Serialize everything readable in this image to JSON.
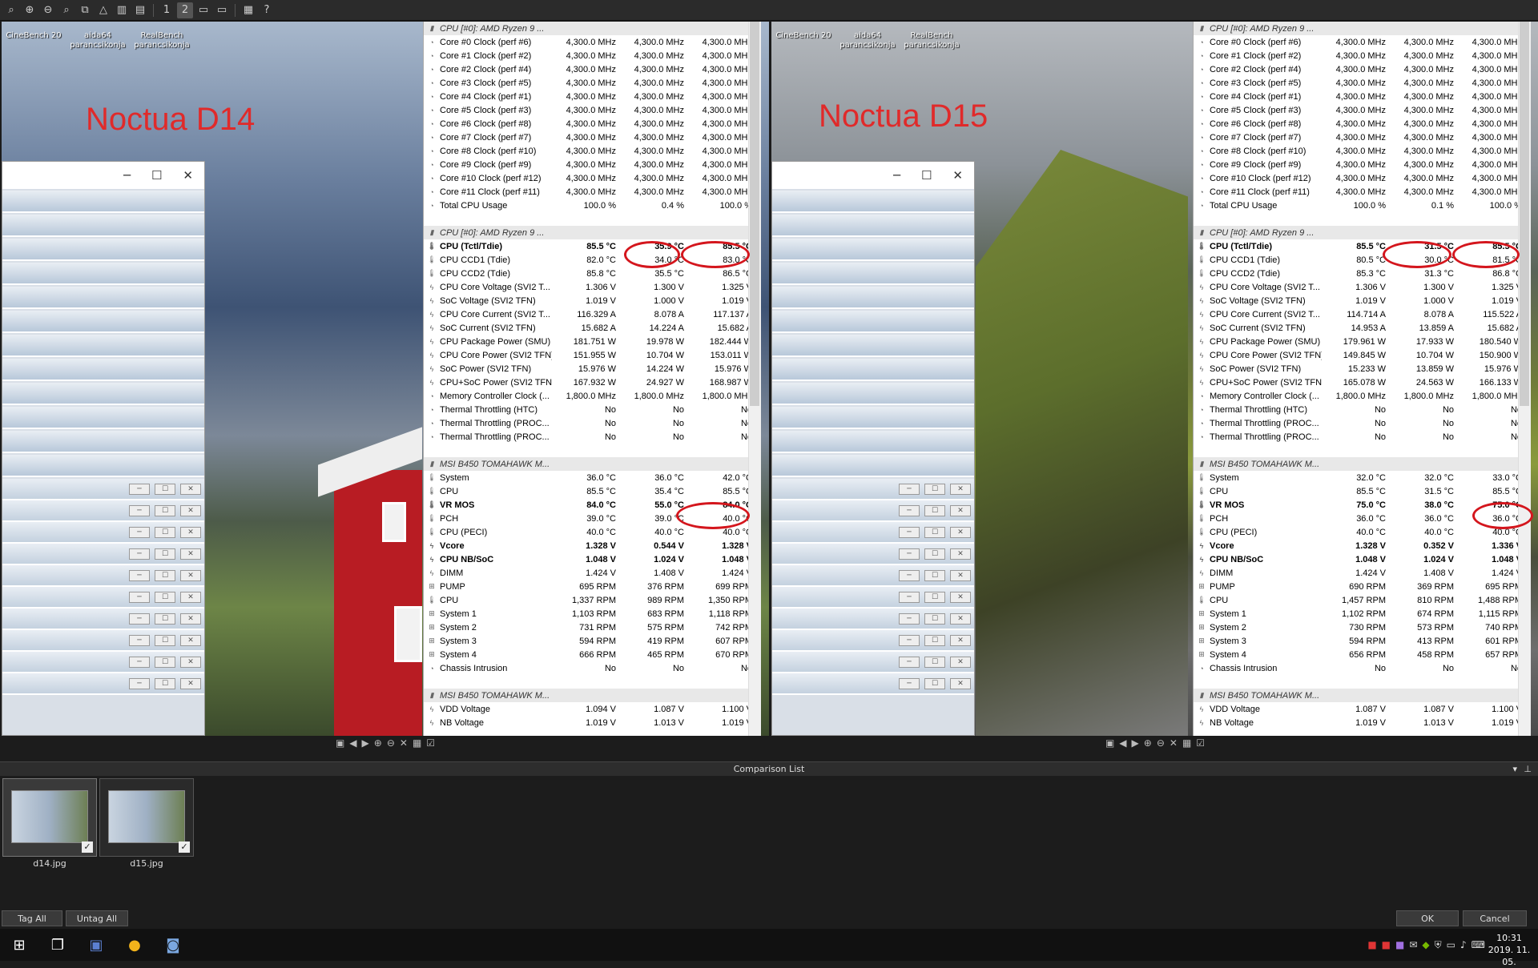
{
  "toolbar": {
    "icons": [
      "search-icon",
      "zoom-in-icon",
      "zoom-out-icon",
      "zoom-icon",
      "copy-icon",
      "sharpen-icon",
      "histogram-icon",
      "adjust-icon",
      "layout-1-icon",
      "layout-2-icon",
      "layout-3-icon",
      "layout-4-icon",
      "grid-icon",
      "help-icon"
    ],
    "layout1": "1",
    "layout2": "2"
  },
  "panels": [
    {
      "title": "Noctua D14",
      "desktop_icons": [
        "CineBench 20",
        "aida64 parancsikonja",
        "RealBench parancsikonja"
      ],
      "hw": [
        {
          "t": "hdr",
          "name": "CPU [#0]: AMD Ryzen 9 ..."
        },
        {
          "name": "Core #0 Clock (perf #6)",
          "a": "4,300.0 MHz",
          "b": "4,300.0 MHz",
          "c": "4,300.0 MHz"
        },
        {
          "name": "Core #1 Clock (perf #2)",
          "a": "4,300.0 MHz",
          "b": "4,300.0 MHz",
          "c": "4,300.0 MHz"
        },
        {
          "name": "Core #2 Clock (perf #4)",
          "a": "4,300.0 MHz",
          "b": "4,300.0 MHz",
          "c": "4,300.0 MHz"
        },
        {
          "name": "Core #3 Clock (perf #5)",
          "a": "4,300.0 MHz",
          "b": "4,300.0 MHz",
          "c": "4,300.0 MHz"
        },
        {
          "name": "Core #4 Clock (perf #1)",
          "a": "4,300.0 MHz",
          "b": "4,300.0 MHz",
          "c": "4,300.0 MHz"
        },
        {
          "name": "Core #5 Clock (perf #3)",
          "a": "4,300.0 MHz",
          "b": "4,300.0 MHz",
          "c": "4,300.0 MHz"
        },
        {
          "name": "Core #6 Clock (perf #8)",
          "a": "4,300.0 MHz",
          "b": "4,300.0 MHz",
          "c": "4,300.0 MHz"
        },
        {
          "name": "Core #7 Clock (perf #7)",
          "a": "4,300.0 MHz",
          "b": "4,300.0 MHz",
          "c": "4,300.0 MHz"
        },
        {
          "name": "Core #8 Clock (perf #10)",
          "a": "4,300.0 MHz",
          "b": "4,300.0 MHz",
          "c": "4,300.0 MHz"
        },
        {
          "name": "Core #9 Clock (perf #9)",
          "a": "4,300.0 MHz",
          "b": "4,300.0 MHz",
          "c": "4,300.0 MHz"
        },
        {
          "name": "Core #10 Clock (perf #12)",
          "a": "4,300.0 MHz",
          "b": "4,300.0 MHz",
          "c": "4,300.0 MHz"
        },
        {
          "name": "Core #11 Clock (perf #11)",
          "a": "4,300.0 MHz",
          "b": "4,300.0 MHz",
          "c": "4,300.0 MHz"
        },
        {
          "name": "Total CPU Usage",
          "a": "100.0 %",
          "b": "0.4 %",
          "c": "100.0 %"
        },
        {
          "t": "gap"
        },
        {
          "t": "hdr",
          "name": "CPU [#0]: AMD Ryzen 9 ..."
        },
        {
          "t": "b",
          "name": "CPU (Tctl/Tdie)",
          "a": "85.5 °C",
          "b": "35.9 °C",
          "c": "85.5 °C"
        },
        {
          "name": "CPU CCD1 (Tdie)",
          "a": "82.0 °C",
          "b": "34.0 °C",
          "c": "83.0 °C"
        },
        {
          "name": "CPU CCD2 (Tdie)",
          "a": "85.8 °C",
          "b": "35.5 °C",
          "c": "86.5 °C"
        },
        {
          "name": "CPU Core Voltage (SVI2 T...",
          "a": "1.306 V",
          "b": "1.300 V",
          "c": "1.325 V"
        },
        {
          "name": "SoC Voltage (SVI2 TFN)",
          "a": "1.019 V",
          "b": "1.000 V",
          "c": "1.019 V"
        },
        {
          "name": "CPU Core Current (SVI2 T...",
          "a": "116.329 A",
          "b": "8.078 A",
          "c": "117.137 A"
        },
        {
          "name": "SoC Current (SVI2 TFN)",
          "a": "15.682 A",
          "b": "14.224 A",
          "c": "15.682 A"
        },
        {
          "name": "CPU Package Power (SMU)",
          "a": "181.751 W",
          "b": "19.978 W",
          "c": "182.444 W"
        },
        {
          "name": "CPU Core Power (SVI2 TFN)",
          "a": "151.955 W",
          "b": "10.704 W",
          "c": "153.011 W"
        },
        {
          "name": "SoC Power (SVI2 TFN)",
          "a": "15.976 W",
          "b": "14.224 W",
          "c": "15.976 W"
        },
        {
          "name": "CPU+SoC Power (SVI2 TFN)",
          "a": "167.932 W",
          "b": "24.927 W",
          "c": "168.987 W"
        },
        {
          "name": "Memory Controller Clock (...",
          "a": "1,800.0 MHz",
          "b": "1,800.0 MHz",
          "c": "1,800.0 MHz"
        },
        {
          "name": "Thermal Throttling (HTC)",
          "a": "No",
          "b": "No",
          "c": "No"
        },
        {
          "name": "Thermal Throttling (PROC...",
          "a": "No",
          "b": "No",
          "c": "No"
        },
        {
          "name": "Thermal Throttling (PROC...",
          "a": "No",
          "b": "No",
          "c": "No"
        },
        {
          "t": "gap"
        },
        {
          "t": "hdr",
          "name": "MSI B450 TOMAHAWK M..."
        },
        {
          "name": "System",
          "a": "36.0 °C",
          "b": "36.0 °C",
          "c": "42.0 °C"
        },
        {
          "name": "CPU",
          "a": "85.5 °C",
          "b": "35.4 °C",
          "c": "85.5 °C"
        },
        {
          "t": "b",
          "name": "VR MOS",
          "a": "84.0 °C",
          "b": "55.0 °C",
          "c": "84.0 °C"
        },
        {
          "name": "PCH",
          "a": "39.0 °C",
          "b": "39.0 °C",
          "c": "40.0 °C"
        },
        {
          "name": "CPU (PECI)",
          "a": "40.0 °C",
          "b": "40.0 °C",
          "c": "40.0 °C"
        },
        {
          "t": "b",
          "name": "Vcore",
          "a": "1.328 V",
          "b": "0.544 V",
          "c": "1.328 V"
        },
        {
          "t": "b",
          "name": "CPU NB/SoC",
          "a": "1.048 V",
          "b": "1.024 V",
          "c": "1.048 V"
        },
        {
          "name": "DIMM",
          "a": "1.424 V",
          "b": "1.408 V",
          "c": "1.424 V"
        },
        {
          "name": "PUMP",
          "a": "695 RPM",
          "b": "376 RPM",
          "c": "699 RPM"
        },
        {
          "name": "CPU",
          "a": "1,337 RPM",
          "b": "989 RPM",
          "c": "1,350 RPM"
        },
        {
          "name": "System 1",
          "a": "1,103 RPM",
          "b": "683 RPM",
          "c": "1,118 RPM"
        },
        {
          "name": "System 2",
          "a": "731 RPM",
          "b": "575 RPM",
          "c": "742 RPM"
        },
        {
          "name": "System 3",
          "a": "594 RPM",
          "b": "419 RPM",
          "c": "607 RPM"
        },
        {
          "name": "System 4",
          "a": "666 RPM",
          "b": "465 RPM",
          "c": "670 RPM"
        },
        {
          "name": "Chassis Intrusion",
          "a": "No",
          "b": "No",
          "c": "No"
        },
        {
          "t": "gap"
        },
        {
          "t": "hdr",
          "name": "MSI B450 TOMAHAWK M..."
        },
        {
          "name": "VDD Voltage",
          "a": "1.094 V",
          "b": "1.087 V",
          "c": "1.100 V"
        },
        {
          "name": "NB Voltage",
          "a": "1.019 V",
          "b": "1.013 V",
          "c": "1.019 V"
        }
      ]
    },
    {
      "title": "Noctua D15",
      "desktop_icons": [
        "CineBench 20",
        "aida64 parancsikonja",
        "RealBench parancsikonja"
      ],
      "hw": [
        {
          "t": "hdr",
          "name": "CPU [#0]: AMD Ryzen 9 ..."
        },
        {
          "name": "Core #0 Clock (perf #6)",
          "a": "4,300.0 MHz",
          "b": "4,300.0 MHz",
          "c": "4,300.0 MHz"
        },
        {
          "name": "Core #1 Clock (perf #2)",
          "a": "4,300.0 MHz",
          "b": "4,300.0 MHz",
          "c": "4,300.0 MHz"
        },
        {
          "name": "Core #2 Clock (perf #4)",
          "a": "4,300.0 MHz",
          "b": "4,300.0 MHz",
          "c": "4,300.0 MHz"
        },
        {
          "name": "Core #3 Clock (perf #5)",
          "a": "4,300.0 MHz",
          "b": "4,300.0 MHz",
          "c": "4,300.0 MHz"
        },
        {
          "name": "Core #4 Clock (perf #1)",
          "a": "4,300.0 MHz",
          "b": "4,300.0 MHz",
          "c": "4,300.0 MHz"
        },
        {
          "name": "Core #5 Clock (perf #3)",
          "a": "4,300.0 MHz",
          "b": "4,300.0 MHz",
          "c": "4,300.0 MHz"
        },
        {
          "name": "Core #6 Clock (perf #8)",
          "a": "4,300.0 MHz",
          "b": "4,300.0 MHz",
          "c": "4,300.0 MHz"
        },
        {
          "name": "Core #7 Clock (perf #7)",
          "a": "4,300.0 MHz",
          "b": "4,300.0 MHz",
          "c": "4,300.0 MHz"
        },
        {
          "name": "Core #8 Clock (perf #10)",
          "a": "4,300.0 MHz",
          "b": "4,300.0 MHz",
          "c": "4,300.0 MHz"
        },
        {
          "name": "Core #9 Clock (perf #9)",
          "a": "4,300.0 MHz",
          "b": "4,300.0 MHz",
          "c": "4,300.0 MHz"
        },
        {
          "name": "Core #10 Clock (perf #12)",
          "a": "4,300.0 MHz",
          "b": "4,300.0 MHz",
          "c": "4,300.0 MHz"
        },
        {
          "name": "Core #11 Clock (perf #11)",
          "a": "4,300.0 MHz",
          "b": "4,300.0 MHz",
          "c": "4,300.0 MHz"
        },
        {
          "name": "Total CPU Usage",
          "a": "100.0 %",
          "b": "0.1 %",
          "c": "100.0 %"
        },
        {
          "t": "gap"
        },
        {
          "t": "hdr",
          "name": "CPU [#0]: AMD Ryzen 9 ..."
        },
        {
          "t": "b",
          "name": "CPU (Tctl/Tdie)",
          "a": "85.5 °C",
          "b": "31.5 °C",
          "c": "85.5 °C"
        },
        {
          "name": "CPU CCD1 (Tdie)",
          "a": "80.5 °C",
          "b": "30.0 °C",
          "c": "81.5 °C"
        },
        {
          "name": "CPU CCD2 (Tdie)",
          "a": "85.3 °C",
          "b": "31.3 °C",
          "c": "86.8 °C"
        },
        {
          "name": "CPU Core Voltage (SVI2 T...",
          "a": "1.306 V",
          "b": "1.300 V",
          "c": "1.325 V"
        },
        {
          "name": "SoC Voltage (SVI2 TFN)",
          "a": "1.019 V",
          "b": "1.000 V",
          "c": "1.019 V"
        },
        {
          "name": "CPU Core Current (SVI2 T...",
          "a": "114.714 A",
          "b": "8.078 A",
          "c": "115.522 A"
        },
        {
          "name": "SoC Current (SVI2 TFN)",
          "a": "14.953 A",
          "b": "13.859 A",
          "c": "15.682 A"
        },
        {
          "name": "CPU Package Power (SMU)",
          "a": "179.961 W",
          "b": "17.933 W",
          "c": "180.540 W"
        },
        {
          "name": "CPU Core Power (SVI2 TFN)",
          "a": "149.845 W",
          "b": "10.704 W",
          "c": "150.900 W"
        },
        {
          "name": "SoC Power (SVI2 TFN)",
          "a": "15.233 W",
          "b": "13.859 W",
          "c": "15.976 W"
        },
        {
          "name": "CPU+SoC Power (SVI2 TFN)",
          "a": "165.078 W",
          "b": "24.563 W",
          "c": "166.133 W"
        },
        {
          "name": "Memory Controller Clock (...",
          "a": "1,800.0 MHz",
          "b": "1,800.0 MHz",
          "c": "1,800.0 MHz"
        },
        {
          "name": "Thermal Throttling (HTC)",
          "a": "No",
          "b": "No",
          "c": "No"
        },
        {
          "name": "Thermal Throttling (PROC...",
          "a": "No",
          "b": "No",
          "c": "No"
        },
        {
          "name": "Thermal Throttling (PROC...",
          "a": "No",
          "b": "No",
          "c": "No"
        },
        {
          "t": "gap"
        },
        {
          "t": "hdr",
          "name": "MSI B450 TOMAHAWK M..."
        },
        {
          "name": "System",
          "a": "32.0 °C",
          "b": "32.0 °C",
          "c": "33.0 °C"
        },
        {
          "name": "CPU",
          "a": "85.5 °C",
          "b": "31.5 °C",
          "c": "85.5 °C"
        },
        {
          "t": "b",
          "name": "VR MOS",
          "a": "75.0 °C",
          "b": "38.0 °C",
          "c": "75.0 °C"
        },
        {
          "name": "PCH",
          "a": "36.0 °C",
          "b": "36.0 °C",
          "c": "36.0 °C"
        },
        {
          "name": "CPU (PECI)",
          "a": "40.0 °C",
          "b": "40.0 °C",
          "c": "40.0 °C"
        },
        {
          "t": "b",
          "name": "Vcore",
          "a": "1.328 V",
          "b": "0.352 V",
          "c": "1.336 V"
        },
        {
          "t": "b",
          "name": "CPU NB/SoC",
          "a": "1.048 V",
          "b": "1.024 V",
          "c": "1.048 V"
        },
        {
          "name": "DIMM",
          "a": "1.424 V",
          "b": "1.408 V",
          "c": "1.424 V"
        },
        {
          "name": "PUMP",
          "a": "690 RPM",
          "b": "369 RPM",
          "c": "695 RPM"
        },
        {
          "name": "CPU",
          "a": "1,457 RPM",
          "b": "810 RPM",
          "c": "1,488 RPM"
        },
        {
          "name": "System 1",
          "a": "1,102 RPM",
          "b": "674 RPM",
          "c": "1,115 RPM"
        },
        {
          "name": "System 2",
          "a": "730 RPM",
          "b": "573 RPM",
          "c": "740 RPM"
        },
        {
          "name": "System 3",
          "a": "594 RPM",
          "b": "413 RPM",
          "c": "601 RPM"
        },
        {
          "name": "System 4",
          "a": "656 RPM",
          "b": "458 RPM",
          "c": "657 RPM"
        },
        {
          "name": "Chassis Intrusion",
          "a": "No",
          "b": "No",
          "c": "No"
        },
        {
          "t": "gap"
        },
        {
          "t": "hdr",
          "name": "MSI B450 TOMAHAWK M..."
        },
        {
          "name": "VDD Voltage",
          "a": "1.087 V",
          "b": "1.087 V",
          "c": "1.100 V"
        },
        {
          "name": "NB Voltage",
          "a": "1.019 V",
          "b": "1.013 V",
          "c": "1.019 V"
        }
      ]
    }
  ],
  "comparison": {
    "title": "Comparison List",
    "items": [
      "d14.jpg",
      "d15.jpg"
    ],
    "tag_all": "Tag All",
    "untag_all": "Untag All",
    "ok": "OK",
    "cancel": "Cancel"
  },
  "taskbar": {
    "time": "10:31",
    "date": "2019. 11. 05."
  },
  "colors": {
    "highlight": "#d4161d",
    "label": "#e02a2a"
  }
}
